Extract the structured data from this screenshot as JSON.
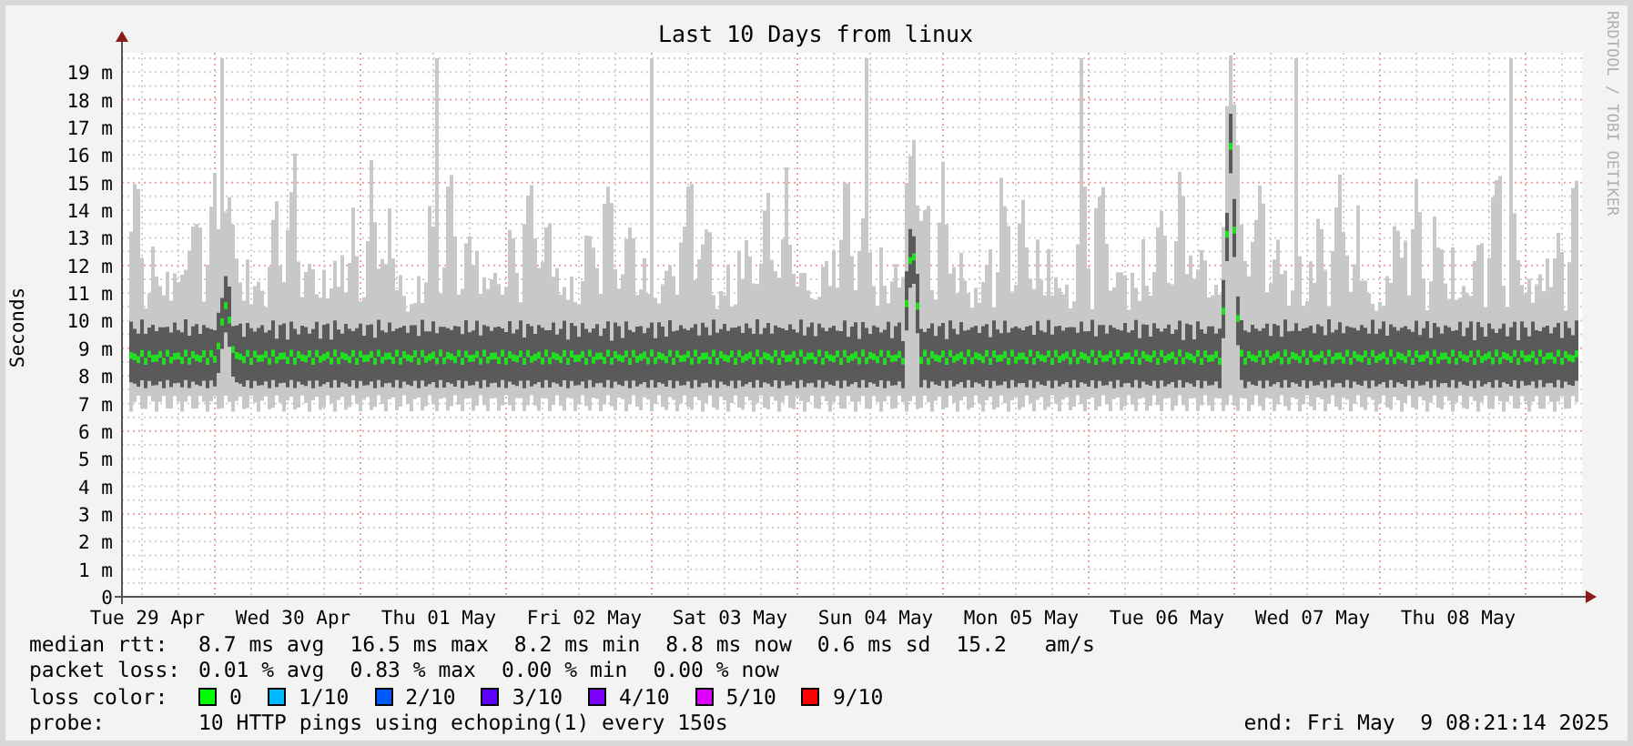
{
  "chart": {
    "chart_data": {
      "type": "line",
      "title": "Last 10 Days from linux",
      "ylabel": "Seconds",
      "categories": [
        "Tue 29 Apr",
        "Wed 30 Apr",
        "Thu 01 May",
        "Fri 02 May",
        "Sat 03 May",
        "Sun 04 May",
        "Mon 05 May",
        "Tue 06 May",
        "Wed 07 May",
        "Thu 08 May"
      ],
      "grid": true,
      "ylim": [
        0,
        19.7
      ],
      "yticks": [
        {
          "value": 0,
          "label": "0"
        },
        {
          "value": 1,
          "label": "1 m"
        },
        {
          "value": 2,
          "label": "2 m"
        },
        {
          "value": 3,
          "label": "3 m"
        },
        {
          "value": 4,
          "label": "4 m"
        },
        {
          "value": 5,
          "label": "5 m"
        },
        {
          "value": 6,
          "label": "6 m"
        },
        {
          "value": 7,
          "label": "7 m"
        },
        {
          "value": 8,
          "label": "8 m"
        },
        {
          "value": 9,
          "label": "9 m"
        },
        {
          "value": 10,
          "label": "10 m"
        },
        {
          "value": 11,
          "label": "11 m"
        },
        {
          "value": 12,
          "label": "12 m"
        },
        {
          "value": 13,
          "label": "13 m"
        },
        {
          "value": 14,
          "label": "14 m"
        },
        {
          "value": 15,
          "label": "15 m"
        },
        {
          "value": 16,
          "label": "16 m"
        },
        {
          "value": 17,
          "label": "17 m"
        },
        {
          "value": 18,
          "label": "18 m"
        },
        {
          "value": 19,
          "label": "19 m"
        }
      ]
    }
  },
  "credit": "RRDTOOL / TOBI OETIKER",
  "legend": [
    {
      "kind": "stats",
      "label": "median rtt:",
      "items": [
        "8.7 ms avg",
        "16.5 ms max",
        "8.2 ms min",
        "8.8 ms now",
        "0.6 ms sd",
        "15.2   am/s"
      ]
    },
    {
      "kind": "stats",
      "label": "packet loss:",
      "items": [
        "0.01 % avg",
        "0.83 % max",
        "0.00 % min",
        "0.00 % now"
      ]
    },
    {
      "kind": "colors",
      "label": "loss color:",
      "swatches": [
        {
          "label": "0",
          "color": "#00ff00"
        },
        {
          "label": "1/10",
          "color": "#00b8ff"
        },
        {
          "label": "2/10",
          "color": "#0059ff"
        },
        {
          "label": "3/10",
          "color": "#5e00ff"
        },
        {
          "label": "4/10",
          "color": "#7e00ff"
        },
        {
          "label": "5/10",
          "color": "#dd00ff"
        },
        {
          "label": "9/10",
          "color": "#ff0000"
        }
      ]
    },
    {
      "kind": "probe",
      "label": "probe:",
      "text": "10 HTTP pings using echoping(1) every 150s",
      "end": "end: Fri May  9 08:21:14 2025"
    }
  ]
}
